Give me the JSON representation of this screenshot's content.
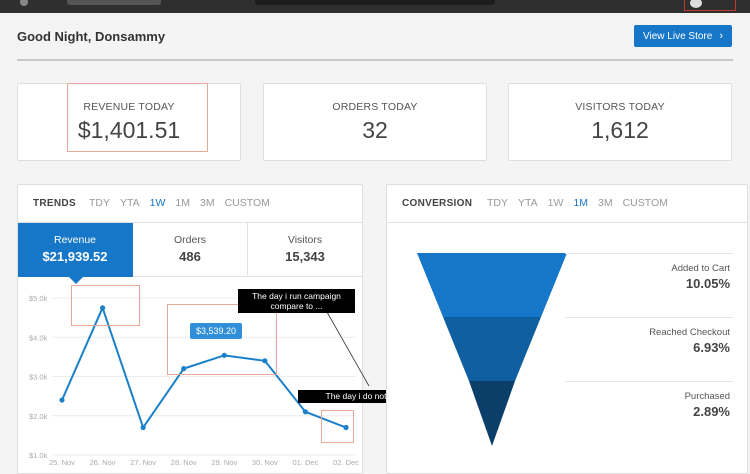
{
  "header": {
    "greeting": "Good Night, Donsammy",
    "live_store_label": "View Live Store"
  },
  "stats": [
    {
      "label": "REVENUE TODAY",
      "value": "$1,401.51"
    },
    {
      "label": "ORDERS TODAY",
      "value": "32"
    },
    {
      "label": "VISITORS TODAY",
      "value": "1,612"
    }
  ],
  "trends": {
    "title": "TRENDS",
    "ranges": [
      "TDY",
      "YTA",
      "1W",
      "1M",
      "3M",
      "CUSTOM"
    ],
    "active_range": "1W",
    "metrics": [
      {
        "label": "Revenue",
        "value": "$21,939.52"
      },
      {
        "label": "Orders",
        "value": "486"
      },
      {
        "label": "Visitors",
        "value": "15,343"
      }
    ],
    "tooltip": "$3,539.20",
    "annotation_1": "The day i run campaign compare to ...",
    "annotation_2": "The day i do not"
  },
  "conversion": {
    "title": "CONVERSION",
    "ranges": [
      "TDY",
      "YTA",
      "1W",
      "1M",
      "3M",
      "CUSTOM"
    ],
    "active_range": "1M",
    "steps": [
      {
        "label": "Added to Cart",
        "value": "10.05%"
      },
      {
        "label": "Reached Checkout",
        "value": "6.93%"
      },
      {
        "label": "Purchased",
        "value": "2.89%"
      }
    ],
    "colors": [
      "#1677c8",
      "#0f5e9f",
      "#0b3f6a"
    ]
  },
  "chart_data": {
    "type": "line",
    "x": [
      "25. Nov",
      "26. Nov",
      "27. Nov",
      "28. Nov",
      "29. Nov",
      "30. Nov",
      "01. Dec",
      "02. Dec"
    ],
    "y_ticks": [
      "$5.0k",
      "$4.0k",
      "$3.0k",
      "$2.0k",
      "$1.0k"
    ],
    "ylim": [
      1000,
      5000
    ],
    "series": [
      {
        "values": [
          2400,
          4750,
          1700,
          3200,
          3539.2,
          3400,
          2100,
          1700
        ],
        "color": "#1a80c9"
      }
    ]
  }
}
